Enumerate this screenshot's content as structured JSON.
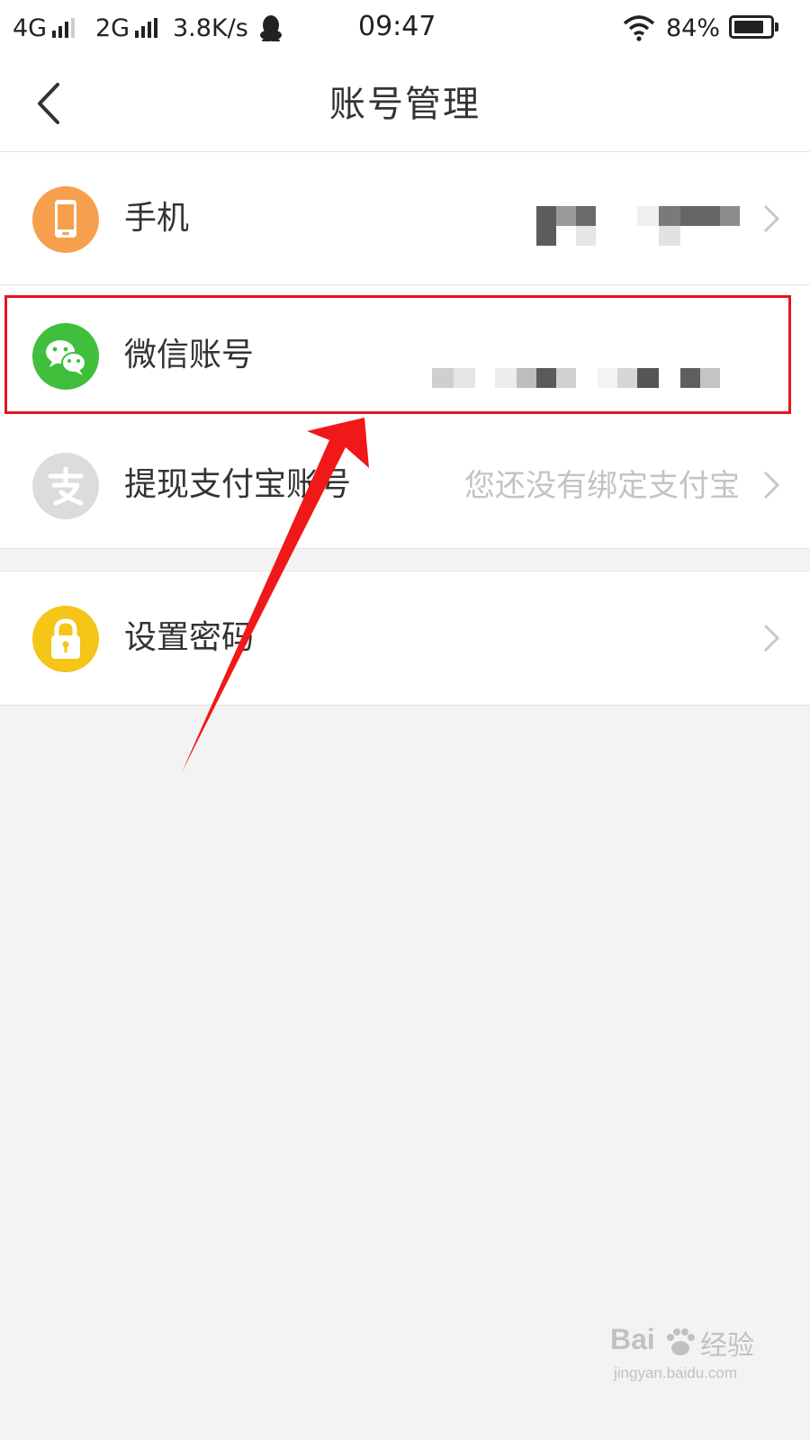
{
  "status_bar": {
    "network1": "4G",
    "network2": "2G",
    "speed": "3.8K/s",
    "time": "09:47",
    "battery": "84%",
    "battery_level": 0.84,
    "icons": [
      "signal-icon",
      "qq-icon",
      "wifi-icon",
      "battery-icon"
    ]
  },
  "header": {
    "title": "账号管理",
    "back_icon": "chevron-left-icon"
  },
  "accounts": [
    {
      "label": "手机",
      "icon": "phone-icon",
      "icon_color": "#f6a04d"
    },
    {
      "label": "微信账号",
      "icon": "wechat-icon",
      "icon_color": "#3fbf3c"
    },
    {
      "label": "提现支付宝账号",
      "value": "您还没有绑定支付宝",
      "icon": "alipay-icon",
      "icon_color": "#dcdcdc"
    }
  ],
  "security": [
    {
      "label": "设置密码",
      "icon": "lock-icon",
      "icon_color": "#f5c518"
    }
  ],
  "watermark": {
    "brand": "Bai",
    "brand2": "经验",
    "url": "jingyan.baidu.com"
  }
}
